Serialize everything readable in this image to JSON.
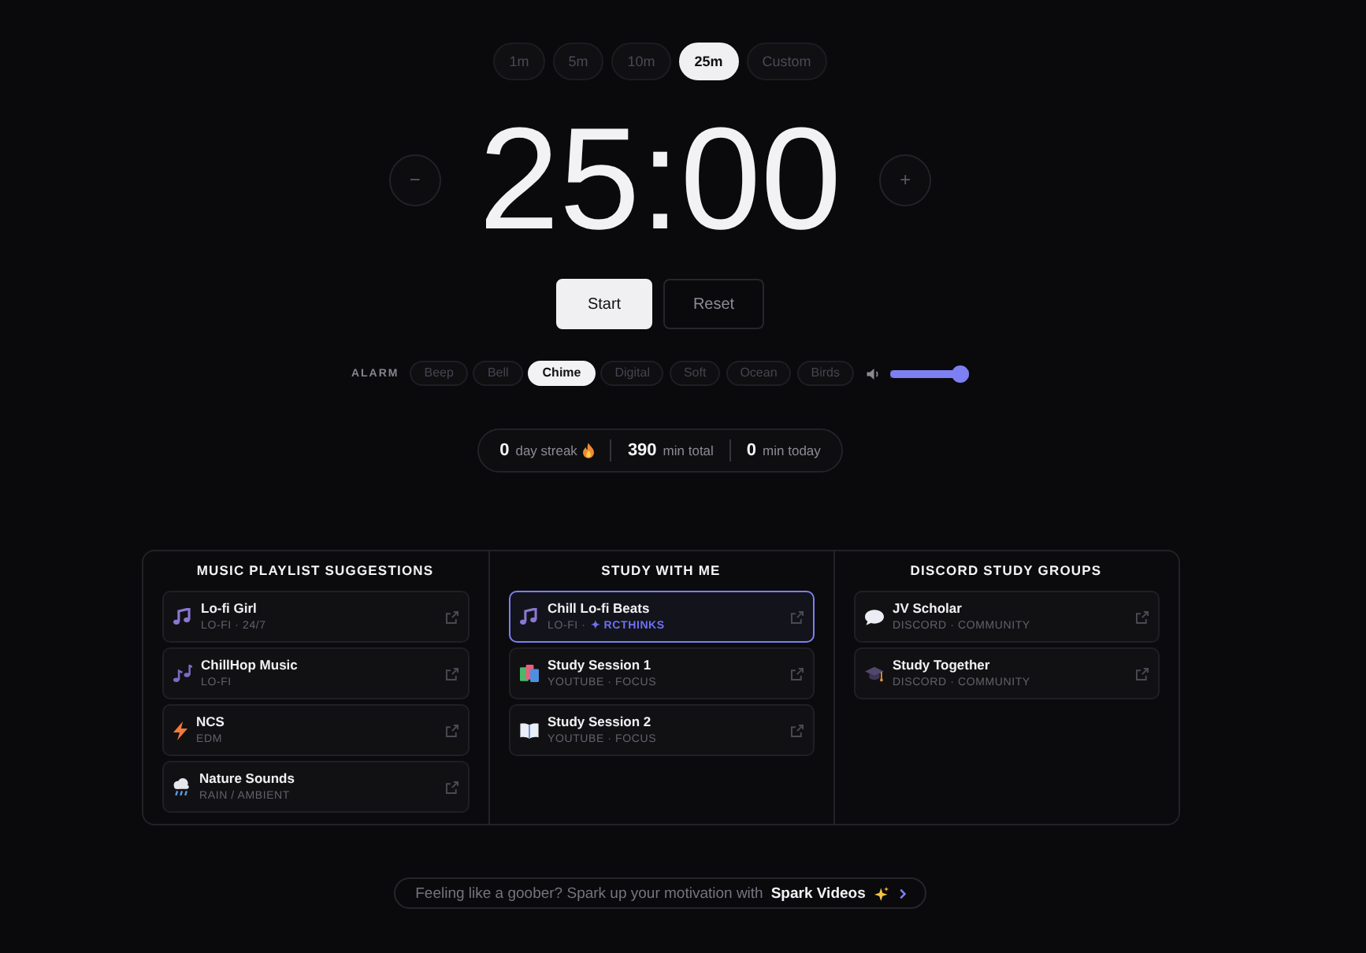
{
  "presets": [
    {
      "label": "1m",
      "selected": false
    },
    {
      "label": "5m",
      "selected": false
    },
    {
      "label": "10m",
      "selected": false
    },
    {
      "label": "25m",
      "selected": true
    },
    {
      "label": "Custom",
      "selected": false
    }
  ],
  "timer": {
    "decrease": "−",
    "time": "25:00",
    "increase": "+"
  },
  "actions": [
    {
      "label": "Start",
      "kind": "primary"
    },
    {
      "label": "Reset",
      "kind": "secondary"
    }
  ],
  "alarm": {
    "label": "ALARM",
    "sounds": [
      {
        "label": "Beep",
        "selected": false
      },
      {
        "label": "Bell",
        "selected": false
      },
      {
        "label": "Chime",
        "selected": true
      },
      {
        "label": "Digital",
        "selected": false
      },
      {
        "label": "Soft",
        "selected": false
      },
      {
        "label": "Ocean",
        "selected": false
      },
      {
        "label": "Birds",
        "selected": false
      }
    ],
    "volume": {
      "level": 1
    }
  },
  "stats": [
    {
      "value": "0",
      "label": "day streak",
      "kind": "streak"
    },
    {
      "value": "390",
      "label": "min total",
      "kind": "plain"
    },
    {
      "value": "0",
      "label": "min today",
      "kind": "plain"
    }
  ],
  "sections": [
    {
      "title": "MUSIC PLAYLIST SUGGESTIONS",
      "items": [
        {
          "kind": "music",
          "title": "Lo-fi Girl",
          "subtitle": "LO-FI · 24/7"
        },
        {
          "kind": "notes",
          "title": "ChillHop Music",
          "subtitle": "LO-FI"
        },
        {
          "kind": "bolt",
          "title": "NCS",
          "subtitle": "EDM"
        },
        {
          "kind": "rain",
          "title": "Nature Sounds",
          "subtitle": "RAIN / AMBIENT"
        }
      ]
    },
    {
      "title": "STUDY WITH ME",
      "items": [
        {
          "kind": "music",
          "title": "Chill Lo-fi Beats",
          "subtitle": "LO-FI ·",
          "tag": "✦ RCTHINKS",
          "featured": true
        },
        {
          "kind": "books",
          "title": "Study Session 1",
          "subtitle": "YOUTUBE · FOCUS",
          "featured": false
        },
        {
          "kind": "book",
          "title": "Study Session 2",
          "subtitle": "YOUTUBE · FOCUS",
          "featured": false
        }
      ]
    },
    {
      "title": "DISCORD STUDY GROUPS",
      "items": [
        {
          "kind": "chat",
          "title": "JV Scholar",
          "subtitle": "DISCORD · COMMUNITY"
        },
        {
          "kind": "cap",
          "title": "Study Together",
          "subtitle": "DISCORD · COMMUNITY"
        }
      ]
    }
  ],
  "banner": {
    "text": "Feeling like a goober? Spark up your motivation with",
    "link": "Spark Videos"
  }
}
